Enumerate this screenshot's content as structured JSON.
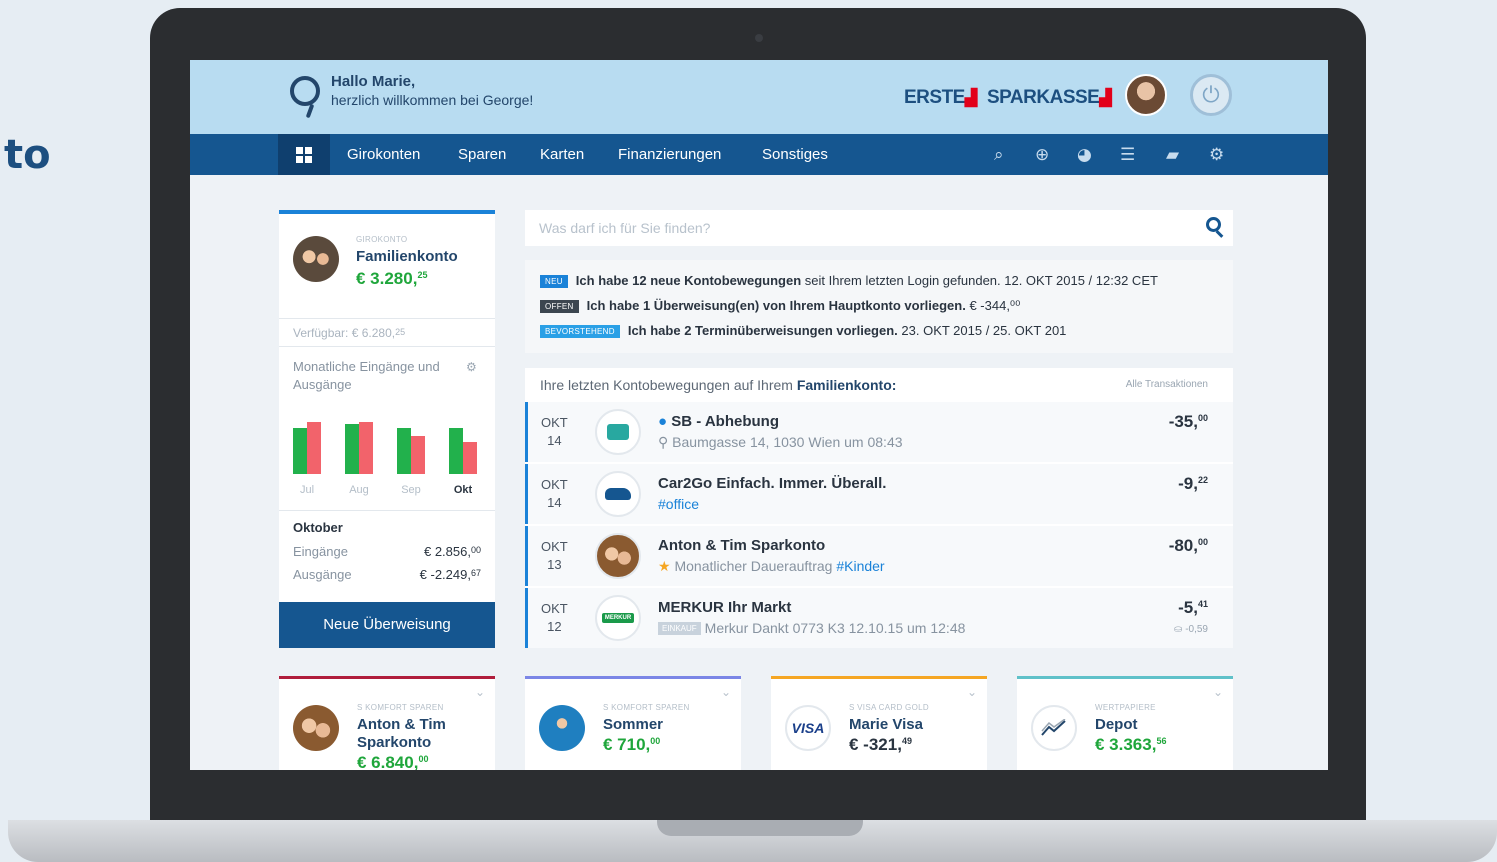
{
  "page_left_text": "to",
  "header": {
    "greeting_name": "Hallo Marie,",
    "greeting_sub": "herzlich willkommen bei George!",
    "brand_erste": "ERSTE",
    "brand_sparkasse": "SPARKASSE"
  },
  "nav": {
    "items": [
      "Girokonten",
      "Sparen",
      "Karten",
      "Finanzierungen",
      "Sonstiges"
    ],
    "icons": [
      "search-icon",
      "plus-icon",
      "chart-icon",
      "notes-icon",
      "chat-icon",
      "gear-icon"
    ]
  },
  "account": {
    "type": "GIROKONTO",
    "name": "Familienkonto",
    "balance_main": "€ 3.280,",
    "balance_cents": "25",
    "available_label": "Verfügbar: € 6.280,",
    "available_cents": "25",
    "monthly_title": "Monatliche Eingänge und Ausgänge",
    "bar_colors": {
      "in": "#22b14c",
      "out": "#f2636b"
    },
    "months": [
      {
        "label": "Jul",
        "in": 0.72,
        "out": 0.81
      },
      {
        "label": "Aug",
        "in": 0.78,
        "out": 0.81
      },
      {
        "label": "Sep",
        "in": 0.72,
        "out": 0.6
      },
      {
        "label": "Okt",
        "in": 0.72,
        "out": 0.5
      }
    ],
    "period_title": "Oktober",
    "income_label": "Eingänge",
    "income_main": "€ 2.856,",
    "income_cents": "00",
    "expense_label": "Ausgänge",
    "expense_main": "€ -2.249,",
    "expense_cents": "67",
    "transfer_button": "Neue Überweisung"
  },
  "search": {
    "placeholder": "Was darf ich für Sie finden?"
  },
  "notifications": [
    {
      "tag": "NEU",
      "tag_color": "#1a82d8",
      "bold": "Ich habe 12 neue Kontobewegungen",
      "rest": " seit Ihrem letzten Login gefunden. 12. OKT 2015 / 12:32 CET"
    },
    {
      "tag": "OFFEN",
      "tag_color": "#3c4650",
      "bold": "Ich habe 1 Überweisung(en) von Ihrem Hauptkonto vorliegen.",
      "rest": " € -344,⁰⁰"
    },
    {
      "tag": "BEVORSTEHEND",
      "tag_color": "#2aa0e6",
      "bold": "Ich habe 2 Terminüberweisungen vorliegen.",
      "rest": " 23. OKT 2015 / 25. OKT 201"
    }
  ],
  "transactions": {
    "header_prefix": "Ihre letzten Kontobewegungen auf Ihrem ",
    "header_account": "Familienkonto:",
    "all_link": "Alle Transaktionen",
    "rows": [
      {
        "month": "OKT",
        "day": "14",
        "title": "SB - Abhebung",
        "sub": "Baumgasse 14, 1030 Wien um 08:43",
        "tag": "",
        "amount": "-35,",
        "cents": "00",
        "extra": ""
      },
      {
        "month": "OKT",
        "day": "14",
        "title": "Car2Go Einfach. Immer. Überall.",
        "sub": "",
        "tag": "#office",
        "amount": "-9,",
        "cents": "22",
        "extra": ""
      },
      {
        "month": "OKT",
        "day": "13",
        "title": "Anton & Tim Sparkonto",
        "sub": "Monatlicher Dauerauftrag",
        "tag": "#Kinder",
        "amount": "-80,",
        "cents": "00",
        "extra": ""
      },
      {
        "month": "OKT",
        "day": "12",
        "title": "MERKUR Ihr Markt",
        "sub": "Merkur Dankt 0773 K3 12.10.15 um 12:48",
        "tag": "EINKAUF",
        "amount": "-5,",
        "cents": "41",
        "extra": "-0,59"
      }
    ],
    "merkur_logo": "MERKUR"
  },
  "products": [
    {
      "type": "S KOMFORT SPAREN",
      "name": "Anton & Tim Sparkonto",
      "bal": "€ 6.840,",
      "cents": "00",
      "color": "#b01e3c",
      "bal_color": "#1fa63b"
    },
    {
      "type": "S KOMFORT SPAREN",
      "name": "Sommer",
      "bal": "€ 710,",
      "cents": "00",
      "color": "#7b86e6",
      "bal_color": "#1fa63b"
    },
    {
      "type": "S VISA CARD GOLD",
      "name": "Marie Visa",
      "bal": "€ -321,",
      "cents": "49",
      "color": "#f5a623",
      "bal_color": "#2a3440"
    },
    {
      "type": "WERTPAPIERE",
      "name": "Depot",
      "bal": "€ 3.363,",
      "cents": "56",
      "color": "#5fc1c9",
      "bal_color": "#1fa63b"
    }
  ],
  "visa_logo": "VISA"
}
